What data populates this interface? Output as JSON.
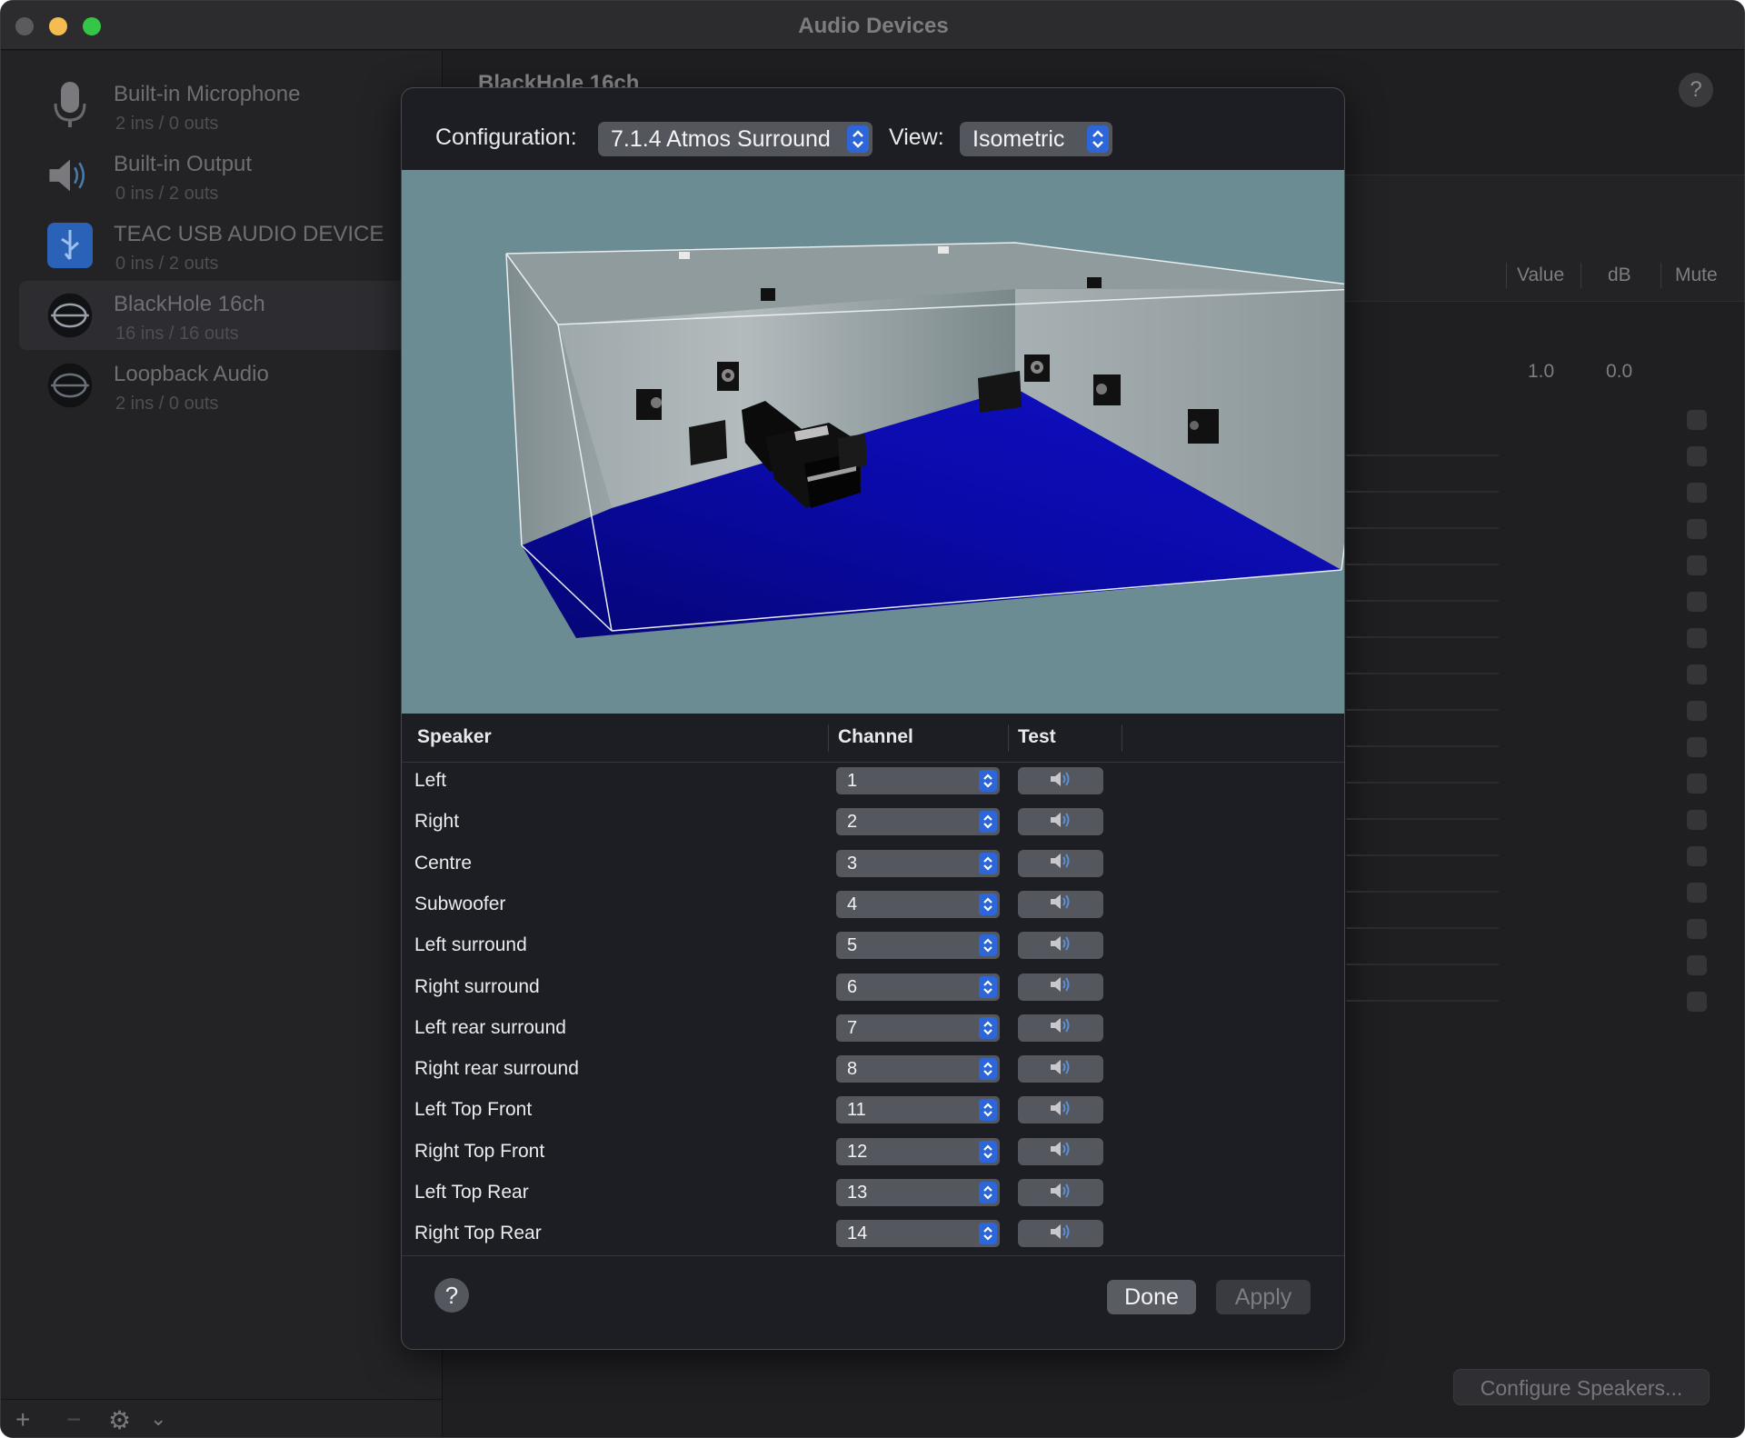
{
  "window": {
    "title": "Audio Devices"
  },
  "sidebar": {
    "devices": [
      {
        "name": "Built-in Microphone",
        "io": "2 ins / 0 outs",
        "icon": "microphone-icon"
      },
      {
        "name": "Built-in Output",
        "io": "0 ins / 2 outs",
        "icon": "speaker-icon"
      },
      {
        "name": "TEAC USB AUDIO DEVICE",
        "io": "0 ins / 2 outs",
        "icon": "usb-icon"
      },
      {
        "name": "BlackHole 16ch",
        "io": "16 ins / 16 outs",
        "icon": "blackhole-icon",
        "selected": true
      },
      {
        "name": "Loopback Audio",
        "io": "2 ins / 0 outs",
        "icon": "loopback-icon"
      }
    ],
    "add": "+",
    "remove": "−",
    "gear": "⚙",
    "chevron": "⌄"
  },
  "main": {
    "device_title": "BlackHole 16ch",
    "help": "?",
    "columns": {
      "value": "Value",
      "db": "dB",
      "mute": "Mute"
    },
    "master": {
      "value": "1.0",
      "db": "0.0"
    },
    "configure_speakers": "Configure Speakers..."
  },
  "sheet": {
    "config_label": "Configuration:",
    "config_value": "7.1.4 Atmos Surround",
    "view_label": "View:",
    "view_value": "Isometric",
    "table_headers": {
      "speaker": "Speaker",
      "channel": "Channel",
      "test": "Test"
    },
    "speakers": [
      {
        "name": "Left",
        "channel": "1"
      },
      {
        "name": "Right",
        "channel": "2"
      },
      {
        "name": "Centre",
        "channel": "3"
      },
      {
        "name": "Subwoofer",
        "channel": "4"
      },
      {
        "name": "Left surround",
        "channel": "5"
      },
      {
        "name": "Right surround",
        "channel": "6"
      },
      {
        "name": "Left rear surround",
        "channel": "7"
      },
      {
        "name": "Right rear surround",
        "channel": "8"
      },
      {
        "name": "Left Top Front",
        "channel": "11"
      },
      {
        "name": "Right Top Front",
        "channel": "12"
      },
      {
        "name": "Left Top Rear",
        "channel": "13"
      },
      {
        "name": "Right Top Rear",
        "channel": "14"
      }
    ],
    "help": "?",
    "done": "Done",
    "apply": "Apply"
  },
  "colors": {
    "accent": "#2c66d9",
    "scene_bg": "#6b8c93",
    "floor": "#0a0a9a"
  }
}
